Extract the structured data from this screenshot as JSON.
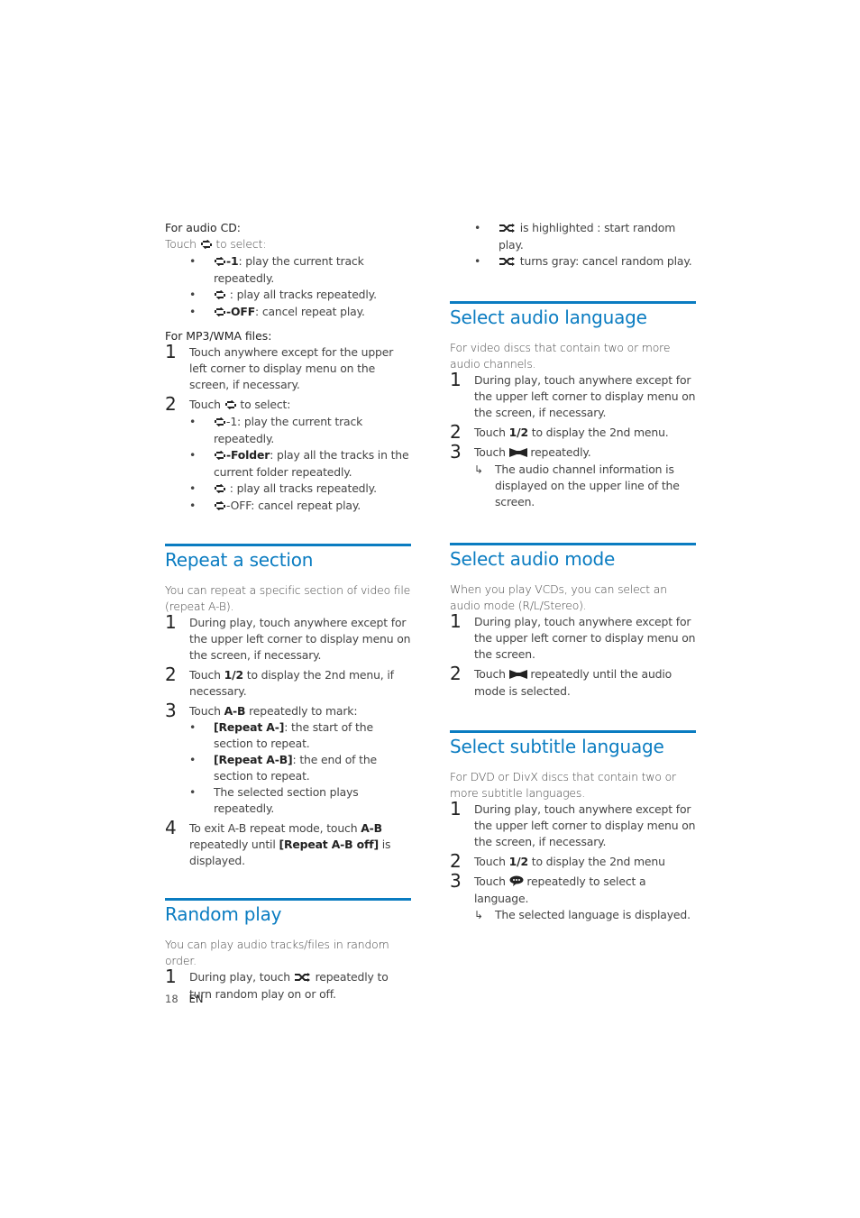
{
  "page": {
    "number": "18",
    "language": "EN",
    "accent_color": "#0a7cc1"
  },
  "left": {
    "audio_cd": {
      "label": "For audio CD:",
      "touch_prefix": "Touch",
      "touch_suffix": "to select:",
      "icon": "repeat-icon",
      "bullets": [
        {
          "bold": "-1",
          "text": ": play the current track repeatedly."
        },
        {
          "bold": "",
          "text": " : play all tracks repeatedly."
        },
        {
          "bold": "-OFF",
          "text": ": cancel repeat play."
        }
      ]
    },
    "mp3_wma": {
      "label": "For MP3/WMA files:",
      "step1": {
        "num": "1",
        "text": "Touch anywhere except for the upper left corner to display menu on the screen, if necessary."
      },
      "step2": {
        "num": "2",
        "prefix": "Touch",
        "suffix": "to select:"
      },
      "bullets": [
        {
          "bold": "",
          "text": "-1: play the current track repeatedly."
        },
        {
          "bold": "-Folder",
          "text": ": play all the tracks in the current folder repeatedly."
        },
        {
          "bold": "",
          "text": " : play all tracks repeatedly."
        },
        {
          "bold": "",
          "text": "-OFF: cancel repeat play."
        }
      ]
    },
    "repeat_section": {
      "title": "Repeat a section",
      "intro": "You can repeat a specific section of video file (repeat A-B).",
      "step1": {
        "num": "1",
        "text": "During play, touch anywhere except for the upper left corner to display menu on the screen, if necessary."
      },
      "step2": {
        "num": "2",
        "prefix": "Touch",
        "key": "1/2",
        "suffix": "to display the 2nd menu, if necessary."
      },
      "step3": {
        "num": "3",
        "prefix": "Touch",
        "key": "A-B",
        "suffix": "repeatedly to mark:"
      },
      "bullets": [
        {
          "bold": "[Repeat A-]",
          "text": ": the start of the section to repeat."
        },
        {
          "bold": "[Repeat A-B]",
          "text": ": the end of the section to repeat."
        },
        {
          "bold": "",
          "text": "The selected section plays repeatedly."
        }
      ],
      "step4": {
        "num": "4",
        "prefix": "To exit A-B repeat mode, touch",
        "key": "A-B",
        "mid": "repeatedly until",
        "bold2": "[Repeat A-B off]",
        "suffix": "is displayed."
      }
    },
    "random_play": {
      "title": "Random play",
      "intro": "You can play audio tracks/files in random order.",
      "step1": {
        "num": "1",
        "prefix": "During play, touch",
        "suffix": "repeatedly to turn random play on or off."
      }
    }
  },
  "right": {
    "random_bullets": [
      {
        "text": "is highlighted : start random play."
      },
      {
        "text": "turns gray: cancel random play."
      }
    ],
    "audio_language": {
      "title": "Select audio language",
      "intro": "For video discs that contain two or more audio channels.",
      "step1": {
        "num": "1",
        "text": "During play, touch anywhere except for the upper left corner to display menu on the screen, if necessary."
      },
      "step2": {
        "num": "2",
        "prefix": "Touch",
        "key": "1/2",
        "suffix": "to display the 2nd menu."
      },
      "step3": {
        "num": "3",
        "prefix": "Touch",
        "suffix": "repeatedly."
      },
      "result": "The audio channel information is displayed on the upper line of the screen."
    },
    "audio_mode": {
      "title": "Select audio mode",
      "intro": "When you play VCDs, you can select an audio mode (R/L/Stereo).",
      "step1": {
        "num": "1",
        "text": "During play, touch anywhere except for the upper left corner to display menu on the screen."
      },
      "step2": {
        "num": "2",
        "prefix": "Touch",
        "suffix": "repeatedly until the audio mode is selected."
      }
    },
    "subtitle_language": {
      "title": "Select subtitle language",
      "intro": "For DVD or DivX discs that contain two or more subtitle languages.",
      "step1": {
        "num": "1",
        "text": "During play, touch anywhere except for the upper left corner to display menu on the screen, if necessary."
      },
      "step2": {
        "num": "2",
        "prefix": "Touch",
        "key": "1/2",
        "suffix": "to display the 2nd menu"
      },
      "step3": {
        "num": "3",
        "prefix": "Touch",
        "suffix": "repeatedly to select a language."
      },
      "result": "The selected language is displayed."
    }
  }
}
